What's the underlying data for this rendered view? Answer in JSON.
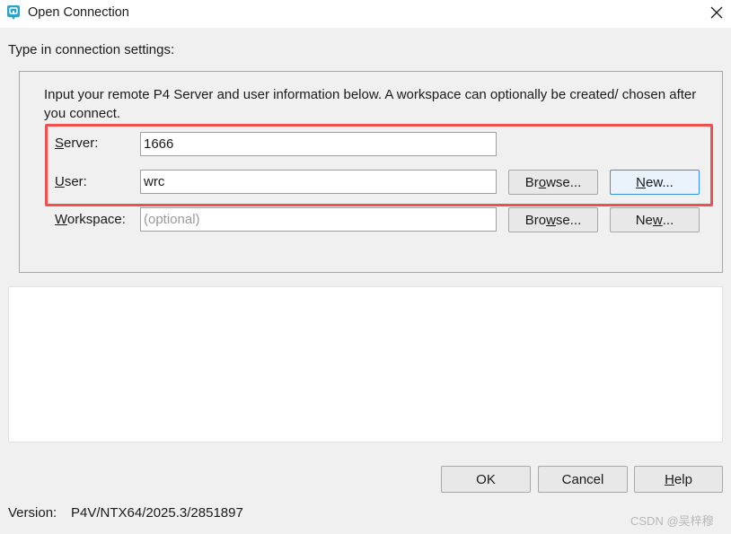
{
  "window": {
    "title": "Open Connection",
    "app_icon": "p4v-icon",
    "close_icon": "close-icon"
  },
  "subtitle": "Type in connection settings:",
  "intro_text": "Input your remote P4 Server and user information below. A workspace can optionally be created/ chosen after you connect.",
  "server": {
    "label_mnemonic": "S",
    "label_rest": "erver:",
    "value": "1666",
    "placeholder": ""
  },
  "user": {
    "label_mnemonic": "U",
    "label_rest": "ser:",
    "value": "wrc",
    "placeholder": "",
    "browse_pre": "Br",
    "browse_mnemonic": "o",
    "browse_post": "wse...",
    "new_pre": "",
    "new_mnemonic": "N",
    "new_post": "ew..."
  },
  "workspace": {
    "label_mnemonic": "W",
    "label_rest": "orkspace:",
    "value": "",
    "placeholder": "(optional)",
    "browse_pre": "Bro",
    "browse_mnemonic": "w",
    "browse_post": "se...",
    "new_pre": "Ne",
    "new_mnemonic": "w",
    "new_post": "..."
  },
  "buttons": {
    "ok": "OK",
    "cancel": "Cancel",
    "help_mnemonic": "H",
    "help_rest": "elp"
  },
  "version": {
    "label": "Version:",
    "value": "P4V/NTX64/2025.3/2851897"
  },
  "watermark": "CSDN @吴梓穆",
  "colors": {
    "highlight": "#f04f4f",
    "focus_border": "#3a8ee6",
    "icon_teal": "#2ba3c4"
  }
}
